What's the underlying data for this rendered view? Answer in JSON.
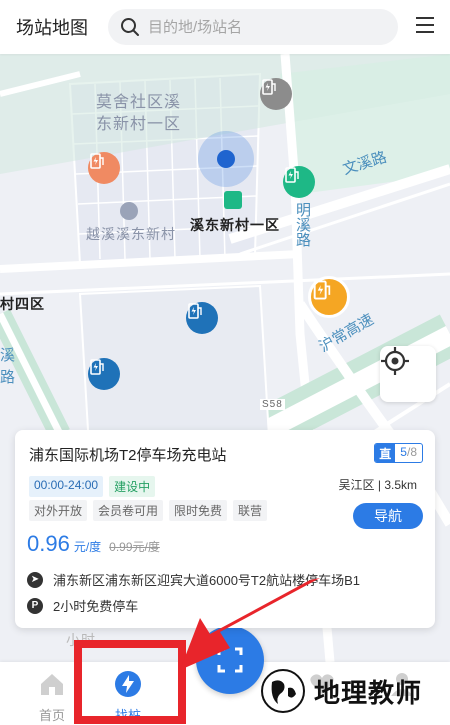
{
  "header": {
    "title": "场站地图",
    "search_placeholder": "目的地/场站名"
  },
  "map": {
    "labels": {
      "community_1a": "莫舍社区溪",
      "community_1b": "东新村一区",
      "community_2": "越溪溪东新村",
      "station_name": "溪东新村一区",
      "district_4": "村四区",
      "road_1": "文溪路",
      "road_2": "明溪路",
      "road_3": "沪常高速",
      "road_4": "路",
      "road_5": "溪",
      "road_id": "S58",
      "bottom_label": "小时"
    }
  },
  "station_card": {
    "name": "浦东国际机场T2停车场充电站",
    "badge_tag": "直",
    "available": "5",
    "total": "/8",
    "hours": "00:00-24:00",
    "status": "建设中",
    "location": "吴江区 | 3.5km",
    "tags": [
      "对外开放",
      "会员卷可用",
      "限时免费",
      "联营"
    ],
    "navigate_label": "导航",
    "price": "0.96",
    "price_unit": "元/度",
    "original_price": "0.99元/度",
    "address": "浦东新区浦东新区迎宾大道6000号T2航站楼停车场B1",
    "parking": "2小时免费停车"
  },
  "bottom_nav": {
    "home": "首页",
    "find_pile": "找桩"
  },
  "watermark": {
    "text": "地理教师"
  },
  "colors": {
    "primary": "#2c7be5",
    "highlight": "#e8252b",
    "station_green": "#1eb886",
    "station_orange": "#f08a62",
    "station_yellow": "#f5a623"
  }
}
